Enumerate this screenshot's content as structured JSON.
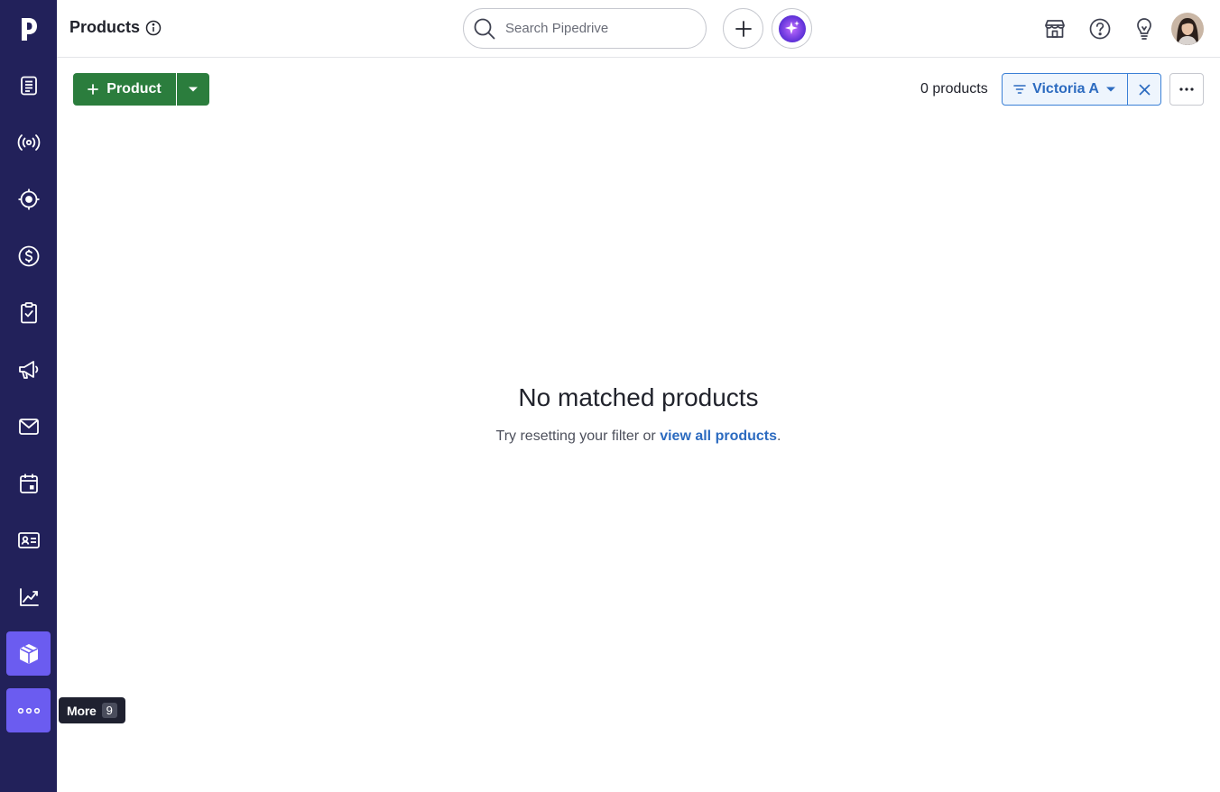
{
  "header": {
    "title": "Products",
    "search_placeholder": "Search Pipedrive"
  },
  "sidebar": {
    "items": [
      {
        "name": "leads-icon"
      },
      {
        "name": "broadcast-icon"
      },
      {
        "name": "target-icon"
      },
      {
        "name": "dollar-icon"
      },
      {
        "name": "clipboard-check-icon"
      },
      {
        "name": "megaphone-icon"
      },
      {
        "name": "mail-icon"
      },
      {
        "name": "calendar-icon"
      },
      {
        "name": "contact-card-icon"
      },
      {
        "name": "chart-icon"
      },
      {
        "name": "box-icon"
      },
      {
        "name": "more-dots-icon"
      }
    ],
    "active": "products",
    "tooltip": {
      "label": "More",
      "shortcut": "9"
    }
  },
  "toolbar": {
    "add_label": "Product",
    "count_label": "0 products",
    "filter_label": "Victoria A"
  },
  "empty_state": {
    "title": "No matched products",
    "text_before": "Try resetting your filter or ",
    "link": "view all products",
    "text_after": "."
  },
  "colors": {
    "sidebar_bg": "#22215a",
    "active_nav": "#6b5cf0",
    "primary_green": "#2b7d3d",
    "link_blue": "#2c6bc0"
  }
}
